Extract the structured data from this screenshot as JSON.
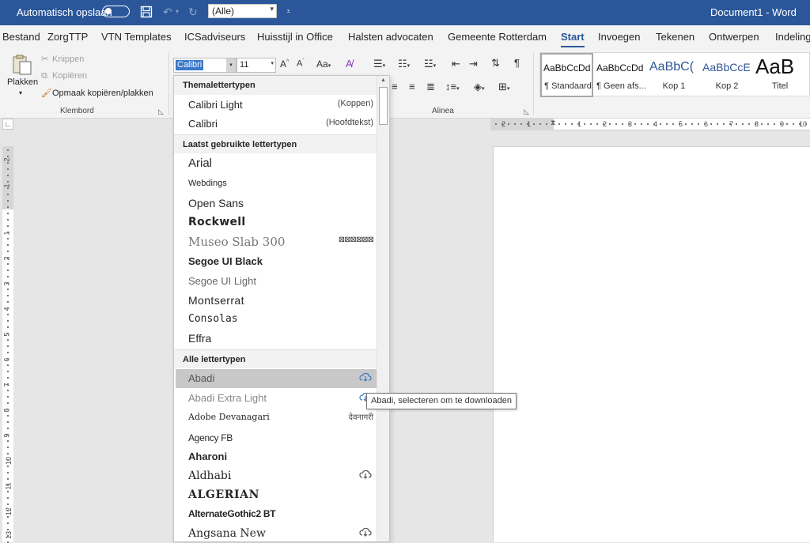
{
  "titlebar": {
    "autosave_label": "Automatisch opslaan",
    "combo_value": "(Alle)",
    "doc_title": "Document1 - Word"
  },
  "tabs": [
    {
      "label": "Bestand"
    },
    {
      "label": "ZorgTTP"
    },
    {
      "label": "VTN Templates"
    },
    {
      "label": "ICSadviseurs"
    },
    {
      "label": "Huisstijl in Office"
    },
    {
      "label": "Halsten advocaten"
    },
    {
      "label": "Gemeente Rotterdam"
    },
    {
      "label": "Start"
    },
    {
      "label": "Invoegen"
    },
    {
      "label": "Tekenen"
    },
    {
      "label": "Ontwerpen"
    },
    {
      "label": "Indeling"
    }
  ],
  "active_tab": "Start",
  "clipboard": {
    "paste_label": "Plakken",
    "cut_label": "Knippen",
    "copy_label": "Kopiëren",
    "format_painter_label": "Opmaak kopiëren/plakken",
    "group_label": "Klembord"
  },
  "font": {
    "name_value": "Calibri",
    "size_value": "11"
  },
  "paragraph": {
    "group_label": "Alinea"
  },
  "styles": [
    {
      "preview": "AaBbCcDd",
      "name": "¶ Standaard"
    },
    {
      "preview": "AaBbCcDd",
      "name": "¶ Geen afs..."
    },
    {
      "preview": "AaBbC(",
      "name": "Kop 1"
    },
    {
      "preview": "AaBbCcE",
      "name": "Kop 2"
    },
    {
      "preview": "AaB",
      "name": "Titel"
    }
  ],
  "font_dropdown": {
    "sections": {
      "theme": "Themalettertypen",
      "recent": "Laatst gebruikte lettertypen",
      "all": "Alle lettertypen"
    },
    "theme_fonts": [
      {
        "name": "Calibri Light",
        "tag": "(Koppen)"
      },
      {
        "name": "Calibri",
        "tag": "(Hoofdtekst)"
      }
    ],
    "recent_fonts": [
      {
        "name": "Arial"
      },
      {
        "name": "Webdings"
      },
      {
        "name": "Open Sans"
      },
      {
        "name": "Rockwell"
      },
      {
        "name": "Museo Slab 300",
        "tag": "⊠⊠⊠⊠⊠⊠"
      },
      {
        "name": "Segoe UI Black"
      },
      {
        "name": "Segoe UI Light"
      },
      {
        "name": "Montserrat"
      },
      {
        "name": "Consolas"
      },
      {
        "name": "Effra"
      }
    ],
    "all_fonts": [
      {
        "name": "Abadi",
        "icon": "cloud-download-icon"
      },
      {
        "name": "Abadi Extra Light",
        "icon": "cloud-download-icon"
      },
      {
        "name": "Adobe Devanagari",
        "tag": "देवनागरी"
      },
      {
        "name": "Agency FB"
      },
      {
        "name": "Aharoni"
      },
      {
        "name": "Aldhabi",
        "icon": "cloud-download-icon"
      },
      {
        "name": "ALGERIAN"
      },
      {
        "name": "AlternateGothic2 BT"
      },
      {
        "name": "Angsana New",
        "icon": "cloud-download-icon"
      }
    ],
    "hovered": "Abadi"
  },
  "tooltip": "Abadi, selecteren om te downloaden",
  "ruler": {
    "h_numbers": [
      "2",
      "1",
      "1",
      "2",
      "3",
      "4",
      "5",
      "6",
      "7",
      "8",
      "9",
      "10"
    ],
    "v_numbers": [
      "2",
      "1",
      "1",
      "2",
      "3",
      "4",
      "5",
      "6",
      "7",
      "8",
      "9",
      "10",
      "11",
      "12",
      "13"
    ]
  },
  "colors": {
    "titlebar": "#2b579a",
    "accent": "#2b579a",
    "hover": "#c8c8c8"
  }
}
